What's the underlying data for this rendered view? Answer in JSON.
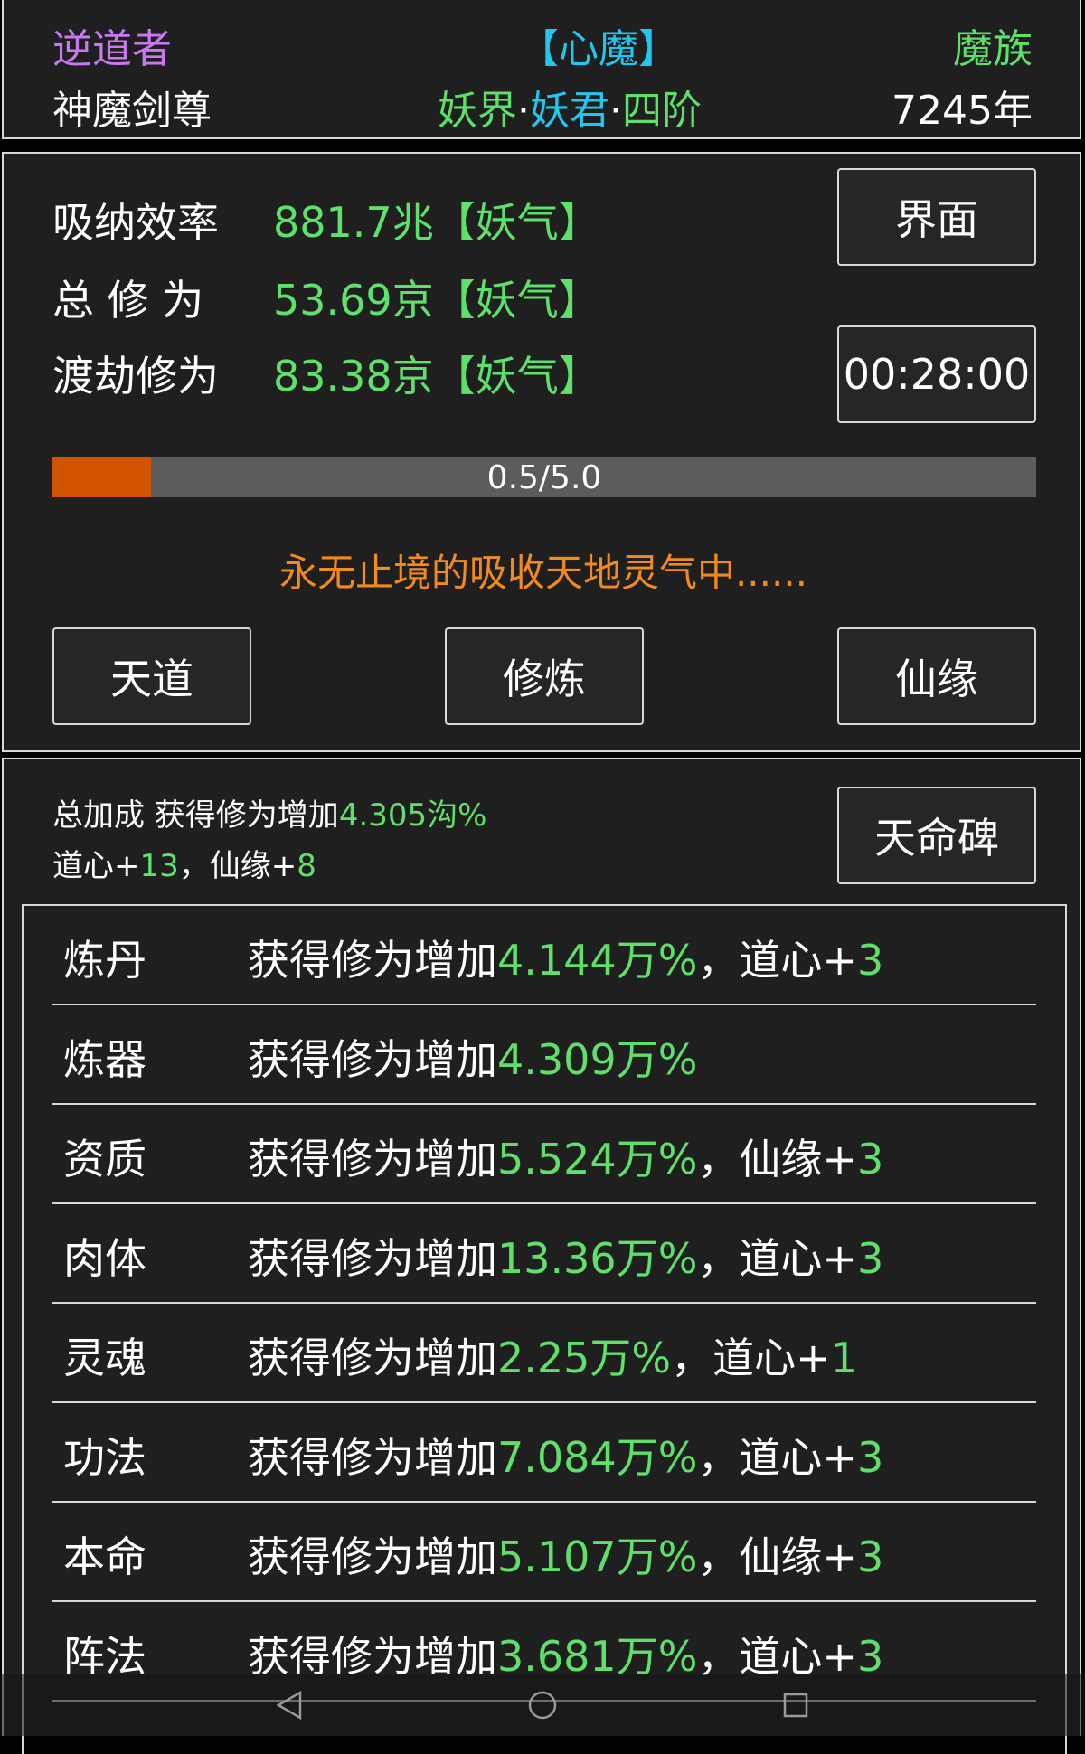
{
  "header": {
    "title": "逆道者",
    "status_tag": "【心魔】",
    "race": "魔族",
    "player_title": "神魔剑尊",
    "realm": {
      "world": "妖界",
      "sep1": "·",
      "rank": "妖君",
      "sep2": "·",
      "stage": "四阶"
    },
    "age": "7245年"
  },
  "stats": [
    {
      "label": "吸纳效率",
      "value": "881.7兆【妖气】"
    },
    {
      "label": "总 修 为",
      "value": "53.69京【妖气】"
    },
    {
      "label": "渡劫修为",
      "value": "83.38京【妖气】"
    }
  ],
  "buttons": {
    "interface": "界面",
    "timer": "00:28:00",
    "tiandao": "天道",
    "cultivate": "修炼",
    "xianyuan": "仙缘",
    "tianming": "天命碑"
  },
  "progress": {
    "text": "0.5/5.0",
    "value": 0.5,
    "max": 5.0
  },
  "status_message": "永无止境的吸收天地灵气中......",
  "summary": {
    "line1_prefix": "总加成 获得修为增加",
    "line1_value": "4.305沟%",
    "line2_a": "道心+",
    "line2_a_val": "13",
    "line2_sep": "，",
    "line2_b": "仙缘+",
    "line2_b_val": "8"
  },
  "bonus_rows": [
    {
      "name": "炼丹",
      "prefix": "获得修为增加",
      "value": "4.144万%",
      "sep": "，",
      "extra": "道心+",
      "extra_val": "3"
    },
    {
      "name": "炼器",
      "prefix": "获得修为增加",
      "value": "4.309万%",
      "sep": "",
      "extra": "",
      "extra_val": ""
    },
    {
      "name": "资质",
      "prefix": "获得修为增加",
      "value": "5.524万%",
      "sep": "，",
      "extra": "仙缘+",
      "extra_val": "3"
    },
    {
      "name": "肉体",
      "prefix": "获得修为增加",
      "value": "13.36万%",
      "sep": "，",
      "extra": "道心+",
      "extra_val": "3"
    },
    {
      "name": "灵魂",
      "prefix": "获得修为增加",
      "value": "2.25万%",
      "sep": "，",
      "extra": "道心+",
      "extra_val": "1"
    },
    {
      "name": "功法",
      "prefix": "获得修为增加",
      "value": "7.084万%",
      "sep": "，",
      "extra": "道心+",
      "extra_val": "3"
    },
    {
      "name": "本命",
      "prefix": "获得修为增加",
      "value": "5.107万%",
      "sep": "，",
      "extra": "仙缘+",
      "extra_val": "3"
    },
    {
      "name": "阵法",
      "prefix": "获得修为增加",
      "value": "3.681万%",
      "sep": "，",
      "extra": "道心+",
      "extra_val": "3"
    }
  ],
  "nav": {
    "back": "back-icon",
    "home": "home-icon",
    "recents": "recents-icon"
  },
  "colors": {
    "green": "#5ee06a",
    "cyan": "#20c8f0",
    "purple": "#c878f0",
    "orange": "#f28a20",
    "progress_fill": "#d15400"
  }
}
